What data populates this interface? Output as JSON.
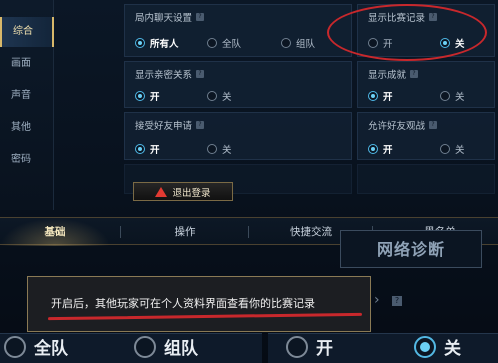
{
  "sidebar": {
    "items": [
      {
        "label": "综合",
        "active": true
      },
      {
        "label": "画面",
        "active": false
      },
      {
        "label": "声音",
        "active": false
      },
      {
        "label": "其他",
        "active": false
      },
      {
        "label": "密码",
        "active": false
      }
    ]
  },
  "panels": {
    "in_game_chat": {
      "title": "局内聊天设置",
      "options": [
        "所有人",
        "全队",
        "组队"
      ],
      "selected": "所有人"
    },
    "show_match_record": {
      "title": "显示比赛记录",
      "options": [
        "开",
        "关"
      ],
      "selected": "关"
    },
    "show_intimacy": {
      "title": "显示亲密关系",
      "options": [
        "开",
        "关"
      ],
      "selected": "开"
    },
    "show_achievements": {
      "title": "显示成就",
      "options": [
        "开",
        "关"
      ],
      "selected": "开"
    },
    "accept_friend_requests": {
      "title": "接受好友申请",
      "options": [
        "开",
        "关"
      ],
      "selected": "开"
    },
    "allow_friend_spectate": {
      "title": "允许好友观战",
      "options": [
        "开",
        "关"
      ],
      "selected": "开"
    }
  },
  "logout_button": {
    "label": "退出登录"
  },
  "tabs": [
    {
      "label": "基础",
      "active": true
    },
    {
      "label": "操作",
      "active": false
    },
    {
      "label": "快捷交流",
      "active": false
    },
    {
      "label": "黑名单",
      "active": false
    }
  ],
  "network_diagnosis": {
    "label": "网络诊断"
  },
  "tooltip": {
    "text": "开启后，其他玩家可在个人资料界面查看你的比赛记录"
  },
  "bottom_row": {
    "options": [
      "全队",
      "组队",
      "开",
      "关"
    ],
    "selected": "关"
  },
  "colors": {
    "accent": "#4fb9e8",
    "highlight": "#c8282c",
    "gold": "#d8b86a"
  },
  "icons": {
    "help": "help-icon",
    "warning": "warning-icon",
    "arrow": "chevron-right-icon"
  }
}
